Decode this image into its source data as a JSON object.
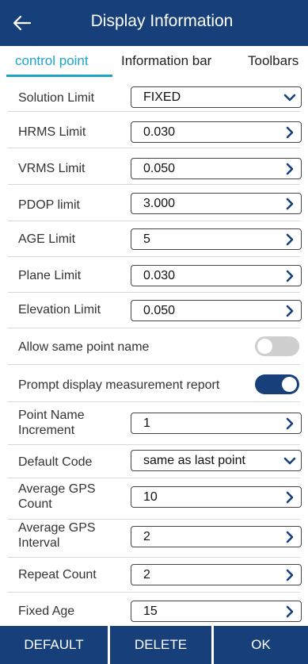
{
  "header": {
    "title": "Display Information",
    "back_icon": "arrow-left-icon"
  },
  "tabs": [
    {
      "label": "control point",
      "active": true
    },
    {
      "label": "Information bar",
      "active": false
    },
    {
      "label": "Toolbars",
      "active": false
    }
  ],
  "settings": {
    "solution_limit": {
      "label": "Solution Limit",
      "value": "FIXED",
      "icon": "chevron-down-icon"
    },
    "hrms_limit": {
      "label": "HRMS Limit",
      "value": "0.030",
      "icon": "chevron-right-icon"
    },
    "vrms_limit": {
      "label": "VRMS Limit",
      "value": "0.050",
      "icon": "chevron-right-icon"
    },
    "pdop_limit": {
      "label": "PDOP limit",
      "value": "3.000",
      "icon": "chevron-right-icon"
    },
    "age_limit": {
      "label": "AGE Limit",
      "value": "5",
      "icon": "chevron-right-icon"
    },
    "plane_limit": {
      "label": "Plane Limit",
      "value": "0.030",
      "icon": "chevron-right-icon"
    },
    "elevation_limit": {
      "label": "Elevation Limit",
      "value": "0.050",
      "icon": "chevron-right-icon"
    },
    "allow_same_point_name": {
      "label": "Allow same point name",
      "enabled": false
    },
    "prompt_display_report": {
      "label": "Prompt display measurement report",
      "enabled": true
    },
    "point_name_increment": {
      "label_line1": "Point Name",
      "label_line2": "Increment",
      "value": "1",
      "icon": "chevron-right-icon"
    },
    "default_code": {
      "label": "Default Code",
      "value": "same as last point",
      "icon": "chevron-down-icon"
    },
    "average_gps_count": {
      "label_line1": "Average GPS",
      "label_line2": "Count",
      "value": "10",
      "icon": "chevron-right-icon"
    },
    "average_gps_interval": {
      "label_line1": "Average GPS",
      "label_line2": "Interval",
      "value": "2",
      "icon": "chevron-right-icon"
    },
    "repeat_count": {
      "label": "Repeat Count",
      "value": "2",
      "icon": "chevron-right-icon"
    },
    "fixed_age": {
      "label": "Fixed Age",
      "value": "15",
      "icon": "chevron-right-icon"
    }
  },
  "footer": {
    "default_label": "DEFAULT",
    "delete_label": "DELETE",
    "ok_label": "OK"
  },
  "colors": {
    "primary": "#17407a",
    "accent": "#1ba6c9",
    "toggle_off": "#cfcfcf"
  }
}
